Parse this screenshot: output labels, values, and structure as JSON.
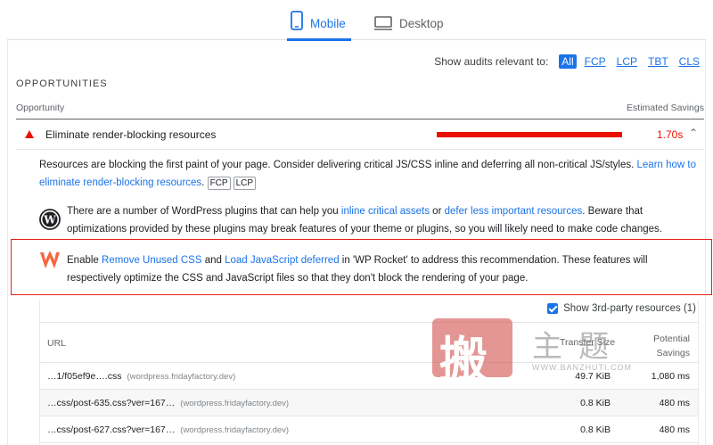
{
  "tabs": {
    "mobile": "Mobile",
    "desktop": "Desktop"
  },
  "filters": {
    "label": "Show audits relevant to:",
    "options": [
      "All",
      "FCP",
      "LCP",
      "TBT",
      "CLS"
    ],
    "active": "All"
  },
  "section": {
    "title": "OPPORTUNITIES"
  },
  "table_header": {
    "left": "Opportunity",
    "right": "Estimated Savings"
  },
  "audit": {
    "title": "Eliminate render-blocking resources",
    "savings": "1.70s",
    "savings_bar_fill": 1.0,
    "status_color": "#eb0f00"
  },
  "description": {
    "text1": "Resources are blocking the first paint of your page. Consider delivering critical JS/CSS inline and deferring all non-critical JS/styles. ",
    "link": "Learn how to eliminate render-blocking resources",
    "text2": ".",
    "tags": [
      "FCP",
      "LCP"
    ]
  },
  "wordpress": {
    "text1": "There are a number of WordPress plugins that can help you ",
    "link1": "inline critical assets",
    "text2": " or ",
    "link2": "defer less important resources",
    "text3": ". Beware that optimizations provided by these plugins may break features of your theme or plugins, so you will likely need to make code changes."
  },
  "wprocket": {
    "text1": "Enable ",
    "link1": "Remove Unused CSS",
    "text2": " and ",
    "link2": "Load JavaScript deferred",
    "text3": " in 'WP Rocket' to address this recommendation. These features will respectively optimize the CSS and JavaScript files so that they don't block the rendering of your page.",
    "highlight_color": "#e8201a"
  },
  "resources": {
    "third_party_label": "Show 3rd-party resources (1)",
    "third_party_checked": true,
    "columns": {
      "url": "URL",
      "transfer": "Transfer Size",
      "savings_line1": "Potential",
      "savings_line2": "Savings"
    },
    "rows": [
      {
        "url": "…1/f05ef9e….css",
        "host": "(wordpress.fridayfactory.dev)",
        "size": "49.7 KiB",
        "savings": "1,080 ms"
      },
      {
        "url": "…css/post-635.css?ver=167…",
        "host": "(wordpress.fridayfactory.dev)",
        "size": "0.8 KiB",
        "savings": "480 ms"
      },
      {
        "url": "…css/post-627.css?ver=167…",
        "host": "(wordpress.fridayfactory.dev)",
        "size": "0.8 KiB",
        "savings": "480 ms"
      }
    ]
  },
  "watermark": {
    "seal": "搬",
    "chars": "主题",
    "url": "WWW.BANZHUTI.COM"
  }
}
